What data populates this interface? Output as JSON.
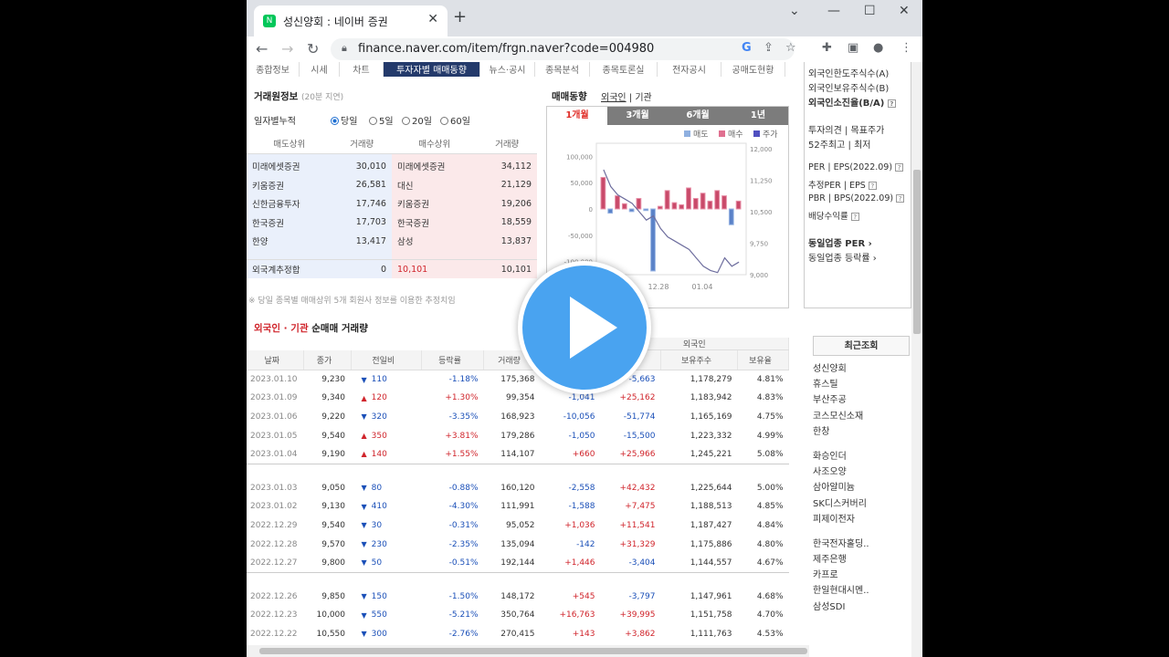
{
  "browser": {
    "tab_title": "성신양회 : 네이버 증권",
    "url": "finance.naver.com/item/frgn.naver?code=004980"
  },
  "subtabs": [
    "종합정보",
    "시세",
    "차트",
    "투자자별 매매동향",
    "뉴스·공시",
    "종목분석",
    "종목토론실",
    "전자공시",
    "공매도현황"
  ],
  "trade_info": {
    "title": "거래원정보",
    "note": "(20분 지연)",
    "period_label": "일자별누적",
    "periods": [
      "당일",
      "5일",
      "20일",
      "60일"
    ],
    "headers": [
      "매도상위",
      "거래량",
      "매수상위",
      "거래량"
    ],
    "rows": [
      [
        "미래에셋증권",
        "30,010",
        "미래에셋증권",
        "34,112"
      ],
      [
        "키움증권",
        "26,581",
        "대신",
        "21,129"
      ],
      [
        "신한금융투자",
        "17,746",
        "키움증권",
        "19,206"
      ],
      [
        "한국증권",
        "17,703",
        "한국증권",
        "18,559"
      ],
      [
        "한양",
        "13,417",
        "삼성",
        "13,837"
      ]
    ],
    "foreign": [
      "외국계추정합",
      "0",
      "10,101",
      "10,101"
    ],
    "footnote": "※ 당일 종목별 매매상위 5개 회원사 정보를 이용한 추정치임"
  },
  "chart_panel": {
    "title": "매매동향",
    "links": [
      "외국인",
      "기관"
    ],
    "tabs": [
      "1개월",
      "3개월",
      "6개월",
      "1년"
    ],
    "legend": [
      "매도",
      "매수",
      "주가"
    ],
    "x_ticks": [
      "12.28",
      "01.04"
    ]
  },
  "chart_data": {
    "type": "bar",
    "y_left": [
      -100000,
      -50000,
      0,
      50000,
      100000
    ],
    "y_left_labels": [
      "-100,000",
      "-50,000",
      "0",
      "50,000",
      "100,000"
    ],
    "y_right": [
      9000,
      9750,
      10500,
      11250,
      12000
    ],
    "y_right_labels": [
      "9,000",
      "9,750",
      "10,500",
      "11,250",
      "12,000"
    ],
    "net_values": [
      60000,
      -8000,
      25000,
      10000,
      -5000,
      20000,
      -3000,
      -118000,
      5000,
      35000,
      12000,
      8000,
      40000,
      20000,
      30000,
      15000,
      35000,
      25000,
      -30000,
      15000
    ],
    "price_values": [
      11500,
      11100,
      10900,
      10800,
      10700,
      10500,
      10300,
      10400,
      10100,
      9900,
      9800,
      9700,
      9600,
      9400,
      9200,
      9100,
      9050,
      9400,
      9200,
      9300
    ]
  },
  "net_trade": {
    "title_a": "외국인 · 기관",
    "title_b": "순매매 거래량",
    "headers": [
      "날짜",
      "종가",
      "전일비",
      "등락률",
      "거래량",
      "기관",
      "외국인",
      "보유주수",
      "보유율"
    ],
    "group_label": "외국인",
    "groups": [
      [
        [
          "2023.01.10",
          "9,230",
          "dn",
          "110",
          "-1.18%",
          "175,368",
          "",
          "-5,663",
          "1,178,279",
          "4.81%"
        ],
        [
          "2023.01.09",
          "9,340",
          "up",
          "120",
          "+1.30%",
          "99,354",
          "-1,041",
          "+25,162",
          "1,183,942",
          "4.83%"
        ],
        [
          "2023.01.06",
          "9,220",
          "dn",
          "320",
          "-3.35%",
          "168,923",
          "-10,056",
          "-51,774",
          "1,165,169",
          "4.75%"
        ],
        [
          "2023.01.05",
          "9,540",
          "up",
          "350",
          "+3.81%",
          "179,286",
          "-1,050",
          "-15,500",
          "1,223,332",
          "4.99%"
        ],
        [
          "2023.01.04",
          "9,190",
          "up",
          "140",
          "+1.55%",
          "114,107",
          "+660",
          "+25,966",
          "1,245,221",
          "5.08%"
        ]
      ],
      [
        [
          "2023.01.03",
          "9,050",
          "dn",
          "80",
          "-0.88%",
          "160,120",
          "-2,558",
          "+42,432",
          "1,225,644",
          "5.00%"
        ],
        [
          "2023.01.02",
          "9,130",
          "dn",
          "410",
          "-4.30%",
          "111,991",
          "-1,588",
          "+7,475",
          "1,188,513",
          "4.85%"
        ],
        [
          "2022.12.29",
          "9,540",
          "dn",
          "30",
          "-0.31%",
          "95,052",
          "+1,036",
          "+11,541",
          "1,187,427",
          "4.84%"
        ],
        [
          "2022.12.28",
          "9,570",
          "dn",
          "230",
          "-2.35%",
          "135,094",
          "-142",
          "+31,329",
          "1,175,886",
          "4.80%"
        ],
        [
          "2022.12.27",
          "9,800",
          "dn",
          "50",
          "-0.51%",
          "192,144",
          "+1,446",
          "-3,404",
          "1,144,557",
          "4.67%"
        ]
      ],
      [
        [
          "2022.12.26",
          "9,850",
          "dn",
          "150",
          "-1.50%",
          "148,172",
          "+545",
          "-3,797",
          "1,147,961",
          "4.68%"
        ],
        [
          "2022.12.23",
          "10,000",
          "dn",
          "550",
          "-5.21%",
          "350,764",
          "+16,763",
          "+39,995",
          "1,151,758",
          "4.70%"
        ],
        [
          "2022.12.22",
          "10,550",
          "dn",
          "300",
          "-2.76%",
          "270,415",
          "+143",
          "+3,862",
          "1,111,763",
          "4.53%"
        ]
      ]
    ]
  },
  "right_panel": {
    "items": [
      "외국인한도주식수(A)",
      "외국인보유주식수(B)",
      "외국인소진율(B/A)"
    ],
    "invest": [
      "투자의견",
      "목표주가"
    ],
    "week52": [
      "52주최고",
      "최저"
    ],
    "per": [
      "PER",
      "EPS(2022.09)"
    ],
    "est": [
      "추정PER",
      "EPS"
    ],
    "pbr": [
      "PBR",
      "BPS(2022.09)"
    ],
    "div": "배당수익률",
    "links": [
      "동일업종 PER",
      "동일업종 등락률"
    ]
  },
  "recent": {
    "title": "최근조회",
    "items": [
      "성신양회",
      "휴스틸",
      "부산주공",
      "코스모신소재",
      "한창",
      "",
      "화승인더",
      "사조오양",
      "삼아알미늄",
      "SK디스커버리",
      "피제이전자",
      "",
      "한국전자홀딩..",
      "제주은행",
      "카프로",
      "한일현대시멘..",
      "삼성SDI"
    ]
  }
}
